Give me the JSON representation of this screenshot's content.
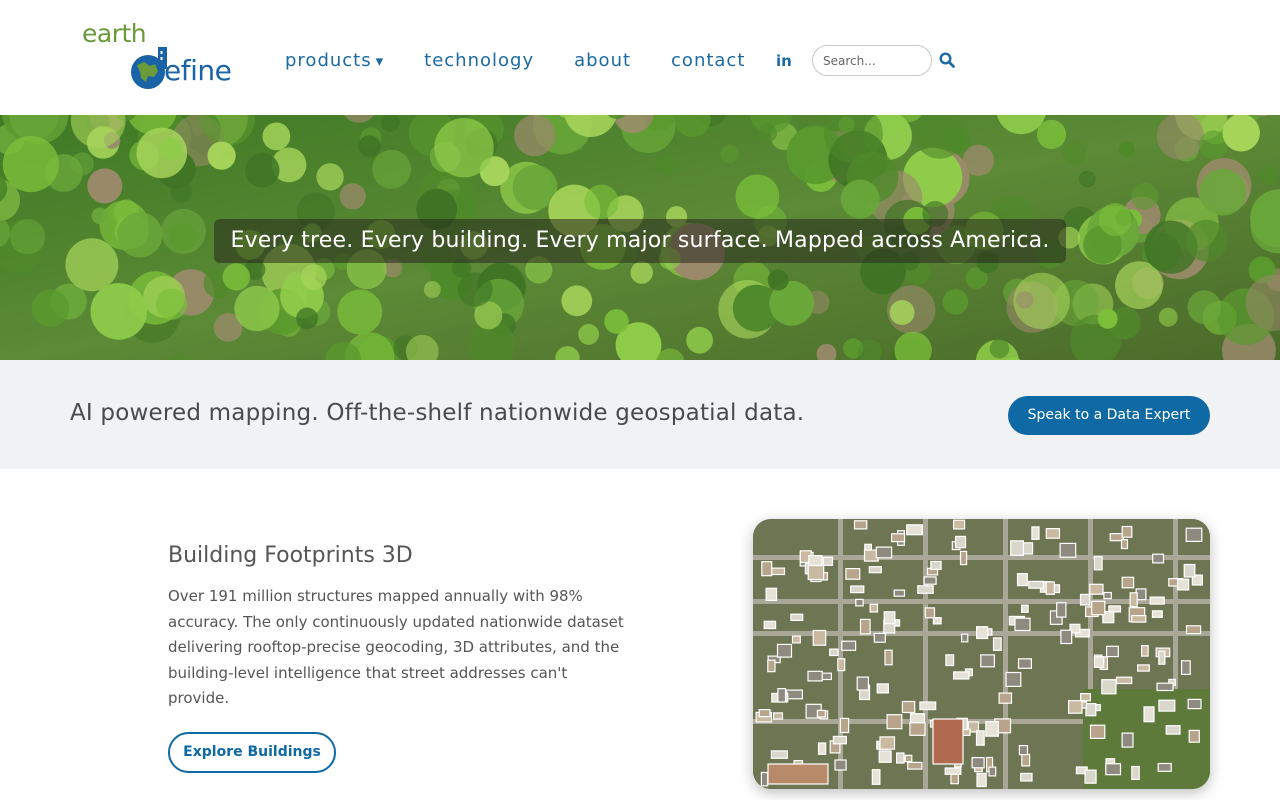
{
  "logo": {
    "top": "earth",
    "bottom": "efine",
    "alt": "earth define"
  },
  "nav": {
    "items": [
      {
        "label": "products",
        "caret": "▾"
      },
      {
        "label": "technology"
      },
      {
        "label": "about"
      },
      {
        "label": "contact"
      }
    ],
    "linkedin": "in"
  },
  "search": {
    "placeholder": "Search..."
  },
  "hero": {
    "caption": "Every tree. Every building. Every major surface. Mapped across America."
  },
  "band": {
    "text": "AI powered mapping. Off-the-shelf nationwide geospatial data.",
    "cta_label": "Speak to a Data Expert"
  },
  "feature": {
    "title": "Building Footprints 3D",
    "body": "Over 191 million structures mapped annually with 98% accuracy. The only continuously updated nationwide dataset delivering rooftop-precise geocoding, 3D attributes, and the building-level intelligence that street addresses can't provide.",
    "button_label": "Explore Buildings"
  },
  "colors": {
    "brand_blue": "#0f69a5",
    "brand_green": "#6a9a3a",
    "nav_text": "#1b6aa5",
    "band_bg": "#f1f2f4"
  },
  "icons": {
    "search": "search-icon",
    "linkedin": "linkedin-icon",
    "caret": "chevron-down-icon"
  }
}
